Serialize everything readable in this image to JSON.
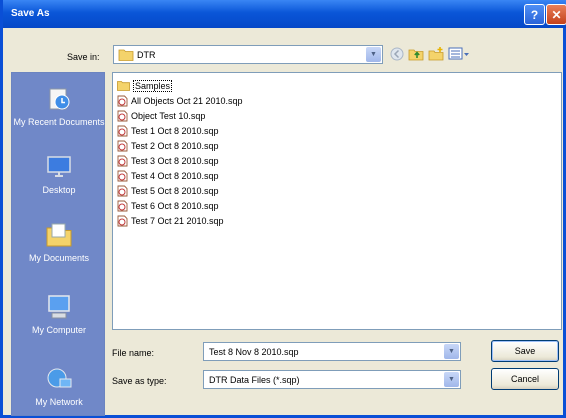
{
  "window": {
    "title": "Save As"
  },
  "titlebar": {
    "help": "?",
    "close": "✕"
  },
  "save_in": {
    "label": "Save in:",
    "value": "DTR"
  },
  "places": [
    {
      "label": "My Recent Documents",
      "icon": "recent-documents-icon"
    },
    {
      "label": "Desktop",
      "icon": "desktop-icon"
    },
    {
      "label": "My Documents",
      "icon": "my-documents-icon"
    },
    {
      "label": "My Computer",
      "icon": "my-computer-icon"
    },
    {
      "label": "My Network",
      "icon": "my-network-icon"
    }
  ],
  "files": [
    {
      "name": "Samples",
      "type": "folder"
    },
    {
      "name": "All Objects Oct 21 2010.sqp",
      "type": "file"
    },
    {
      "name": "Object Test 10.sqp",
      "type": "file"
    },
    {
      "name": "Test 1 Oct 8 2010.sqp",
      "type": "file"
    },
    {
      "name": "Test 2 Oct 8 2010.sqp",
      "type": "file"
    },
    {
      "name": "Test 3 Oct 8 2010.sqp",
      "type": "file"
    },
    {
      "name": "Test 4 Oct 8 2010.sqp",
      "type": "file"
    },
    {
      "name": "Test 5 Oct 8 2010.sqp",
      "type": "file"
    },
    {
      "name": "Test 6 Oct 8 2010.sqp",
      "type": "file"
    },
    {
      "name": "Test 7 Oct 21 2010.sqp",
      "type": "file"
    }
  ],
  "file_name": {
    "label": "File name:",
    "value": "Test 8 Nov 8 2010.sqp"
  },
  "save_as_type": {
    "label": "Save as type:",
    "value": "DTR Data Files (*.sqp)"
  },
  "buttons": {
    "save": "Save",
    "cancel": "Cancel"
  },
  "colors": {
    "titlebar": "#0a56d8",
    "places_bar": "#7088c8",
    "dialog_bg": "#ece9d8"
  }
}
